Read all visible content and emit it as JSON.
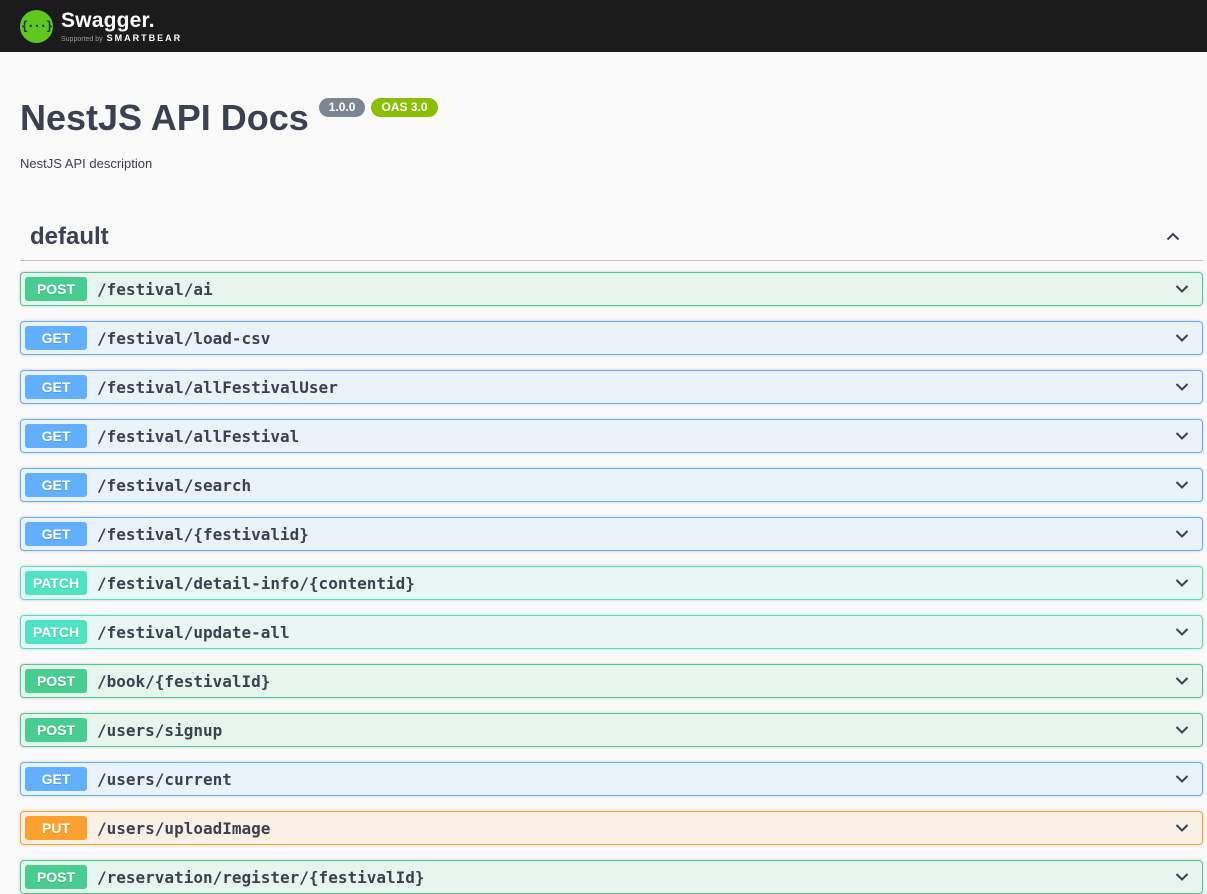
{
  "topbar": {
    "logo_glyph": "{···}",
    "logo_text": "Swagger.",
    "supported_by": "Supported by",
    "brand": "SMARTBEAR",
    "bar_color": "#1b1b1b",
    "logo_green": "#5fc71e"
  },
  "info": {
    "title": "NestJS API Docs",
    "version_badge": "1.0.0",
    "oas_badge": "OAS 3.0",
    "description": "NestJS API description",
    "version_badge_color": "#7d8492",
    "oas_badge_color": "#89bf04"
  },
  "section": {
    "name": "default",
    "expanded": true
  },
  "endpoints": [
    {
      "method": "POST",
      "path": "/festival/ai"
    },
    {
      "method": "GET",
      "path": "/festival/load-csv"
    },
    {
      "method": "GET",
      "path": "/festival/allFestivalUser"
    },
    {
      "method": "GET",
      "path": "/festival/allFestival"
    },
    {
      "method": "GET",
      "path": "/festival/search"
    },
    {
      "method": "GET",
      "path": "/festival/{festivalid}"
    },
    {
      "method": "PATCH",
      "path": "/festival/detail-info/{contentid}"
    },
    {
      "method": "PATCH",
      "path": "/festival/update-all"
    },
    {
      "method": "POST",
      "path": "/book/{festivalId}"
    },
    {
      "method": "POST",
      "path": "/users/signup"
    },
    {
      "method": "GET",
      "path": "/users/current"
    },
    {
      "method": "PUT",
      "path": "/users/uploadImage"
    },
    {
      "method": "POST",
      "path": "/reservation/register/{festivalId}"
    }
  ],
  "method_colors": {
    "POST": "#49cc90",
    "GET": "#61affe",
    "PATCH": "#50e3c2",
    "PUT": "#fca130"
  },
  "ui_colors": {
    "text": "#3b4151",
    "page_background": "#fafafa"
  }
}
